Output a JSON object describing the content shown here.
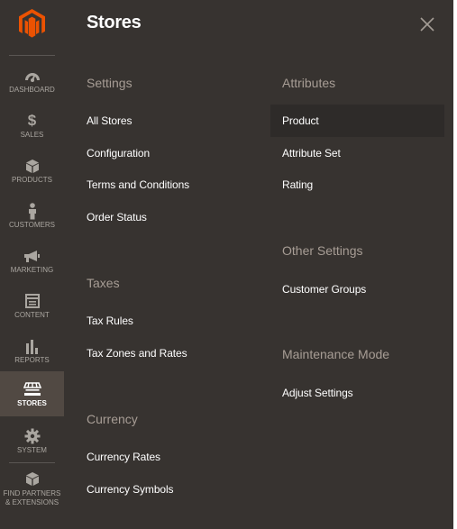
{
  "sidebar": {
    "logo_icon": "magento-logo-icon",
    "accent": "#eb5202",
    "items": [
      {
        "label": "DASHBOARD",
        "icon": "dashboard-icon"
      },
      {
        "label": "SALES",
        "icon": "dollar-icon"
      },
      {
        "label": "PRODUCTS",
        "icon": "cube-icon"
      },
      {
        "label": "CUSTOMERS",
        "icon": "person-icon"
      },
      {
        "label": "MARKETING",
        "icon": "megaphone-icon"
      },
      {
        "label": "CONTENT",
        "icon": "layout-icon"
      },
      {
        "label": "REPORTS",
        "icon": "bar-chart-icon"
      },
      {
        "label": "STORES",
        "icon": "store-icon",
        "active": true
      },
      {
        "label": "SYSTEM",
        "icon": "gear-icon"
      },
      {
        "label_line1": "FIND PARTNERS",
        "label_line2": "& EXTENSIONS",
        "icon": "box-icon"
      }
    ]
  },
  "panel": {
    "title": "Stores",
    "close_icon": "close-icon",
    "columns": {
      "left": [
        {
          "section": "Settings",
          "links": [
            "All Stores",
            "Configuration",
            "Terms and Conditions",
            "Order Status"
          ]
        },
        {
          "section": "Taxes",
          "links": [
            "Tax Rules",
            "Tax Zones and Rates"
          ]
        },
        {
          "section": "Currency",
          "links": [
            "Currency Rates",
            "Currency Symbols"
          ]
        }
      ],
      "right": [
        {
          "section": "Attributes",
          "links": [
            "Product",
            "Attribute Set",
            "Rating"
          ]
        },
        {
          "section": "Other Settings",
          "links": [
            "Customer Groups"
          ]
        },
        {
          "section": "Maintenance Mode",
          "links": [
            "Adjust Settings"
          ]
        }
      ]
    },
    "highlighted_link": "Product"
  }
}
